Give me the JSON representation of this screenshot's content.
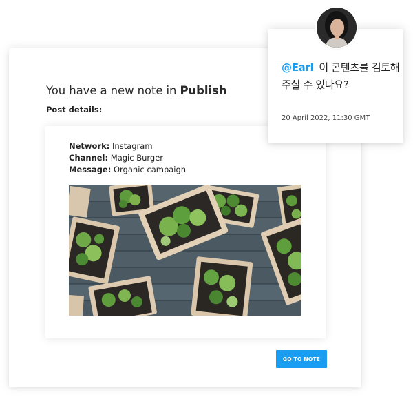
{
  "note": {
    "heading_prefix": "You have a new note in",
    "heading_app": "Publish",
    "post_details_label": "Post details:"
  },
  "post": {
    "network_label": "Network:",
    "network_value": "Instagram",
    "channel_label": "Channel:",
    "channel_value": "Magic Burger",
    "message_label": "Message:",
    "message_value": "Organic campaign"
  },
  "cta": {
    "label": "GO TO NOTE",
    "color": "#1a9cf0"
  },
  "comment": {
    "mention": "@Earl",
    "text": "이 콘텐츠를 검토해주실 수 있나요?",
    "timestamp": "20 April 2022, 11:30 GMT"
  }
}
